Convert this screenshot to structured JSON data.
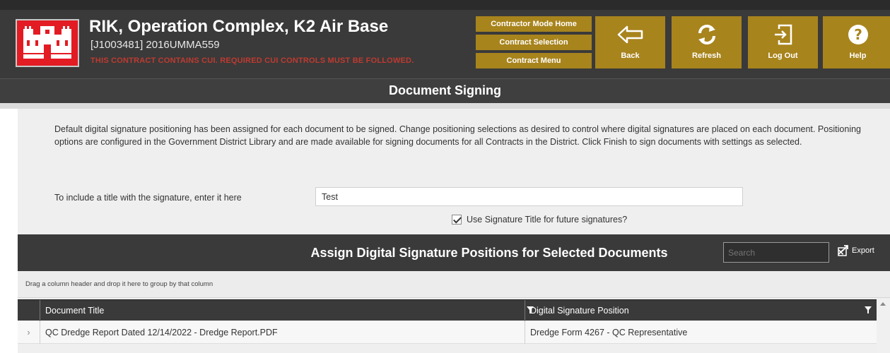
{
  "header": {
    "title": "RIK, Operation Complex, K2 Air Base",
    "subtitle": "[J1003481] 2016UMMA559",
    "warning": "THIS CONTRACT CONTAINS CUI. REQUIRED CUI CONTROLS MUST BE FOLLOWED.",
    "nav_links": [
      "Contractor Mode Home",
      "Contract Selection",
      "Contract Menu"
    ],
    "buttons": {
      "back": "Back",
      "refresh": "Refresh",
      "logout": "Log Out",
      "help": "Help"
    }
  },
  "page_title": "Document Signing",
  "description": "Default digital signature positioning has been assigned for each document to be signed. Change positioning selections as desired to control where digital signatures are placed on each document. Positioning options are configured in the Government District Library and are made available for signing documents for all Contracts in the District. Click Finish to sign documents with settings as selected.",
  "signature_title": {
    "label": "To include a title with the signature, enter it here",
    "value": "Test",
    "checkbox_label": "Use Signature Title for future signatures?",
    "checkbox_checked": true
  },
  "grid": {
    "title": "Assign Digital Signature Positions for Selected Documents",
    "search_placeholder": "Search",
    "export_label": "Export",
    "group_hint": "Drag a column header and drop it here to group by that column",
    "columns": [
      "Document Title",
      "Digital Signature Position"
    ],
    "rows": [
      {
        "document_title": "QC Dredge Report Dated 12/14/2022 - Dredge Report.PDF",
        "signature_position": "Dredge Form 4267 - QC Representative"
      }
    ]
  },
  "colors": {
    "accent_gold": "#a8841d",
    "header_dark": "#3a3a3a",
    "logo_red": "#e31b23",
    "warning_red": "#d63a2f"
  }
}
